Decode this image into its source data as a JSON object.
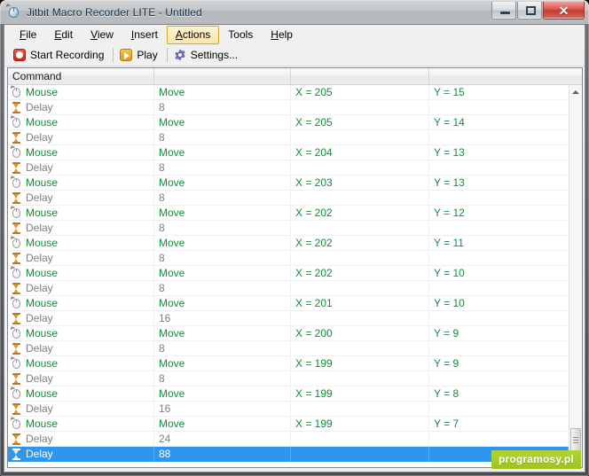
{
  "window": {
    "title": "Jitbit Macro Recorder LITE - Untitled",
    "app_icon": "mouse-cursor-icon",
    "controls": {
      "minimize": "minimize-icon",
      "maximize": "maximize-icon",
      "close": "✕"
    }
  },
  "menubar": {
    "items": [
      {
        "label": "File",
        "accel": "F",
        "active": false
      },
      {
        "label": "Edit",
        "accel": "E",
        "active": false
      },
      {
        "label": "View",
        "accel": "V",
        "active": false
      },
      {
        "label": "Insert",
        "accel": "I",
        "active": false
      },
      {
        "label": "Actions",
        "accel": "A",
        "active": true
      },
      {
        "label": "Tools",
        "accel": "T",
        "active": false
      },
      {
        "label": "Help",
        "accel": "H",
        "active": false
      }
    ]
  },
  "toolbar": {
    "buttons": [
      {
        "label": "Start Recording",
        "icon": "record-icon"
      },
      {
        "label": "Play",
        "icon": "play-icon"
      },
      {
        "label": "Settings...",
        "icon": "gear-icon"
      }
    ]
  },
  "list": {
    "columns": [
      "Command",
      "",
      "",
      ""
    ],
    "rows": [
      {
        "type": "mouse",
        "icon": "mouse-icon",
        "command": "Mouse",
        "action": "Move",
        "x": "X = 205",
        "y": "Y = 15",
        "selected": false
      },
      {
        "type": "delay",
        "icon": "hourglass-icon",
        "command": "Delay",
        "action": "8",
        "x": "",
        "y": "",
        "selected": false
      },
      {
        "type": "mouse",
        "icon": "mouse-icon",
        "command": "Mouse",
        "action": "Move",
        "x": "X = 205",
        "y": "Y = 14",
        "selected": false
      },
      {
        "type": "delay",
        "icon": "hourglass-icon",
        "command": "Delay",
        "action": "8",
        "x": "",
        "y": "",
        "selected": false
      },
      {
        "type": "mouse",
        "icon": "mouse-icon",
        "command": "Mouse",
        "action": "Move",
        "x": "X = 204",
        "y": "Y = 13",
        "selected": false
      },
      {
        "type": "delay",
        "icon": "hourglass-icon",
        "command": "Delay",
        "action": "8",
        "x": "",
        "y": "",
        "selected": false
      },
      {
        "type": "mouse",
        "icon": "mouse-icon",
        "command": "Mouse",
        "action": "Move",
        "x": "X = 203",
        "y": "Y = 13",
        "selected": false
      },
      {
        "type": "delay",
        "icon": "hourglass-icon",
        "command": "Delay",
        "action": "8",
        "x": "",
        "y": "",
        "selected": false
      },
      {
        "type": "mouse",
        "icon": "mouse-icon",
        "command": "Mouse",
        "action": "Move",
        "x": "X = 202",
        "y": "Y = 12",
        "selected": false
      },
      {
        "type": "delay",
        "icon": "hourglass-icon",
        "command": "Delay",
        "action": "8",
        "x": "",
        "y": "",
        "selected": false
      },
      {
        "type": "mouse",
        "icon": "mouse-icon",
        "command": "Mouse",
        "action": "Move",
        "x": "X = 202",
        "y": "Y = 11",
        "selected": false
      },
      {
        "type": "delay",
        "icon": "hourglass-icon",
        "command": "Delay",
        "action": "8",
        "x": "",
        "y": "",
        "selected": false
      },
      {
        "type": "mouse",
        "icon": "mouse-icon",
        "command": "Mouse",
        "action": "Move",
        "x": "X = 202",
        "y": "Y = 10",
        "selected": false
      },
      {
        "type": "delay",
        "icon": "hourglass-icon",
        "command": "Delay",
        "action": "8",
        "x": "",
        "y": "",
        "selected": false
      },
      {
        "type": "mouse",
        "icon": "mouse-icon",
        "command": "Mouse",
        "action": "Move",
        "x": "X = 201",
        "y": "Y = 10",
        "selected": false
      },
      {
        "type": "delay",
        "icon": "hourglass-icon",
        "command": "Delay",
        "action": "16",
        "x": "",
        "y": "",
        "selected": false
      },
      {
        "type": "mouse",
        "icon": "mouse-icon",
        "command": "Mouse",
        "action": "Move",
        "x": "X = 200",
        "y": "Y = 9",
        "selected": false
      },
      {
        "type": "delay",
        "icon": "hourglass-icon",
        "command": "Delay",
        "action": "8",
        "x": "",
        "y": "",
        "selected": false
      },
      {
        "type": "mouse",
        "icon": "mouse-icon",
        "command": "Mouse",
        "action": "Move",
        "x": "X = 199",
        "y": "Y = 9",
        "selected": false
      },
      {
        "type": "delay",
        "icon": "hourglass-icon",
        "command": "Delay",
        "action": "8",
        "x": "",
        "y": "",
        "selected": false
      },
      {
        "type": "mouse",
        "icon": "mouse-icon",
        "command": "Mouse",
        "action": "Move",
        "x": "X = 199",
        "y": "Y = 8",
        "selected": false
      },
      {
        "type": "delay",
        "icon": "hourglass-icon",
        "command": "Delay",
        "action": "16",
        "x": "",
        "y": "",
        "selected": false
      },
      {
        "type": "mouse",
        "icon": "mouse-icon",
        "command": "Mouse",
        "action": "Move",
        "x": "X = 199",
        "y": "Y = 7",
        "selected": false
      },
      {
        "type": "delay",
        "icon": "hourglass-icon",
        "command": "Delay",
        "action": "24",
        "x": "",
        "y": "",
        "selected": false
      },
      {
        "type": "delay",
        "icon": "hourglass-icon",
        "command": "Delay",
        "action": "88",
        "x": "",
        "y": "",
        "selected": true
      }
    ]
  },
  "scrollbar": {
    "up_icon": "scroll-up-arrow-icon",
    "down_icon": "scroll-down-arrow-icon"
  },
  "watermark": {
    "text": "programosy.pl"
  },
  "colors": {
    "mouse_text": "#168a3b",
    "delay_text": "#808080",
    "selection": "#2f96ed",
    "menu_highlight": "#f9e6a8",
    "watermark": "#a8cc2b"
  }
}
